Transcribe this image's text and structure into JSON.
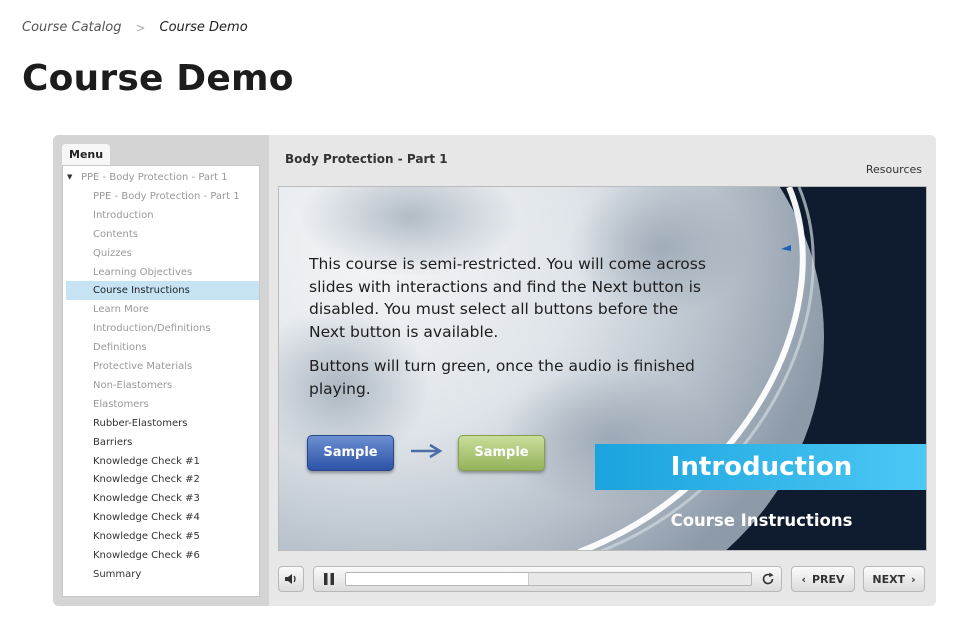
{
  "breadcrumb": {
    "items": [
      "Course Catalog",
      "Course Demo"
    ],
    "separator": ">"
  },
  "page": {
    "title": "Course Demo"
  },
  "player": {
    "menu_tab": "Menu",
    "menu_items": [
      {
        "label": "PPE - Body Protection - Part 1",
        "state": "parent"
      },
      {
        "label": "PPE - Body Protection - Part 1",
        "state": "visited"
      },
      {
        "label": "Introduction",
        "state": "visited"
      },
      {
        "label": "Contents",
        "state": "visited"
      },
      {
        "label": "Quizzes",
        "state": "visited"
      },
      {
        "label": "Learning Objectives",
        "state": "visited"
      },
      {
        "label": "Course Instructions",
        "state": "active"
      },
      {
        "label": "Learn More",
        "state": "visited"
      },
      {
        "label": "Introduction/Definitions",
        "state": "visited"
      },
      {
        "label": "Definitions",
        "state": "visited"
      },
      {
        "label": "Protective Materials",
        "state": "visited"
      },
      {
        "label": "Non-Elastomers",
        "state": "visited"
      },
      {
        "label": "Elastomers",
        "state": "visited"
      },
      {
        "label": "Rubber-Elastomers",
        "state": "unvisited"
      },
      {
        "label": "Barriers",
        "state": "unvisited"
      },
      {
        "label": "Knowledge Check #1",
        "state": "unvisited"
      },
      {
        "label": "Knowledge Check #2",
        "state": "unvisited"
      },
      {
        "label": "Knowledge Check #3",
        "state": "unvisited"
      },
      {
        "label": "Knowledge Check #4",
        "state": "unvisited"
      },
      {
        "label": "Knowledge Check #5",
        "state": "unvisited"
      },
      {
        "label": "Knowledge Check #6",
        "state": "unvisited"
      },
      {
        "label": "Summary",
        "state": "unvisited"
      }
    ],
    "slide_title": "Body Protection - Part 1",
    "resources_label": "Resources",
    "slide": {
      "paragraph1": "This course is semi-restricted. You will come across slides with interactions and find the Next button is disabled. You must select all buttons before the Next button is available.",
      "paragraph2": "Buttons will turn green, once the audio is finished playing.",
      "sample_blue": "Sample",
      "sample_green": "Sample",
      "intro_heading": "Introduction",
      "intro_subheading": "Course Instructions"
    },
    "controls": {
      "prev_label": "PREV",
      "next_label": "NEXT",
      "progress": 0.45
    }
  },
  "colors": {
    "active_menu": "#c5e3f3",
    "intro_band": "#29abe2",
    "stage_dark": "#0f1b2e",
    "sample_blue": "#3a62b8",
    "sample_green": "#a9c470"
  }
}
